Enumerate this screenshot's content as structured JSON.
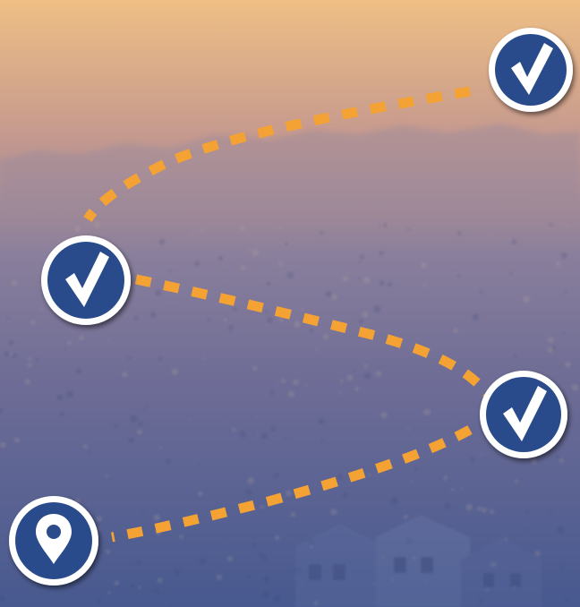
{
  "colors": {
    "sky_top": "#efbf85",
    "sky_mid": "#c69a8e",
    "haze": "#8a7f9c",
    "valley_top": "#6f6d96",
    "valley_bottom": "#47598f",
    "mountain": "#9b8a9d",
    "path_dash": "#f4a233",
    "badge_fill": "#2c4b8b",
    "badge_ring": "#ffffff",
    "badge_shadow": "#1a2238",
    "glyph": "#ffffff"
  },
  "route": {
    "steps": [
      {
        "icon": "checkmark-icon",
        "status": "completed"
      },
      {
        "icon": "checkmark-icon",
        "status": "completed"
      },
      {
        "icon": "checkmark-icon",
        "status": "completed"
      },
      {
        "icon": "location-pin-icon",
        "status": "current"
      }
    ]
  }
}
